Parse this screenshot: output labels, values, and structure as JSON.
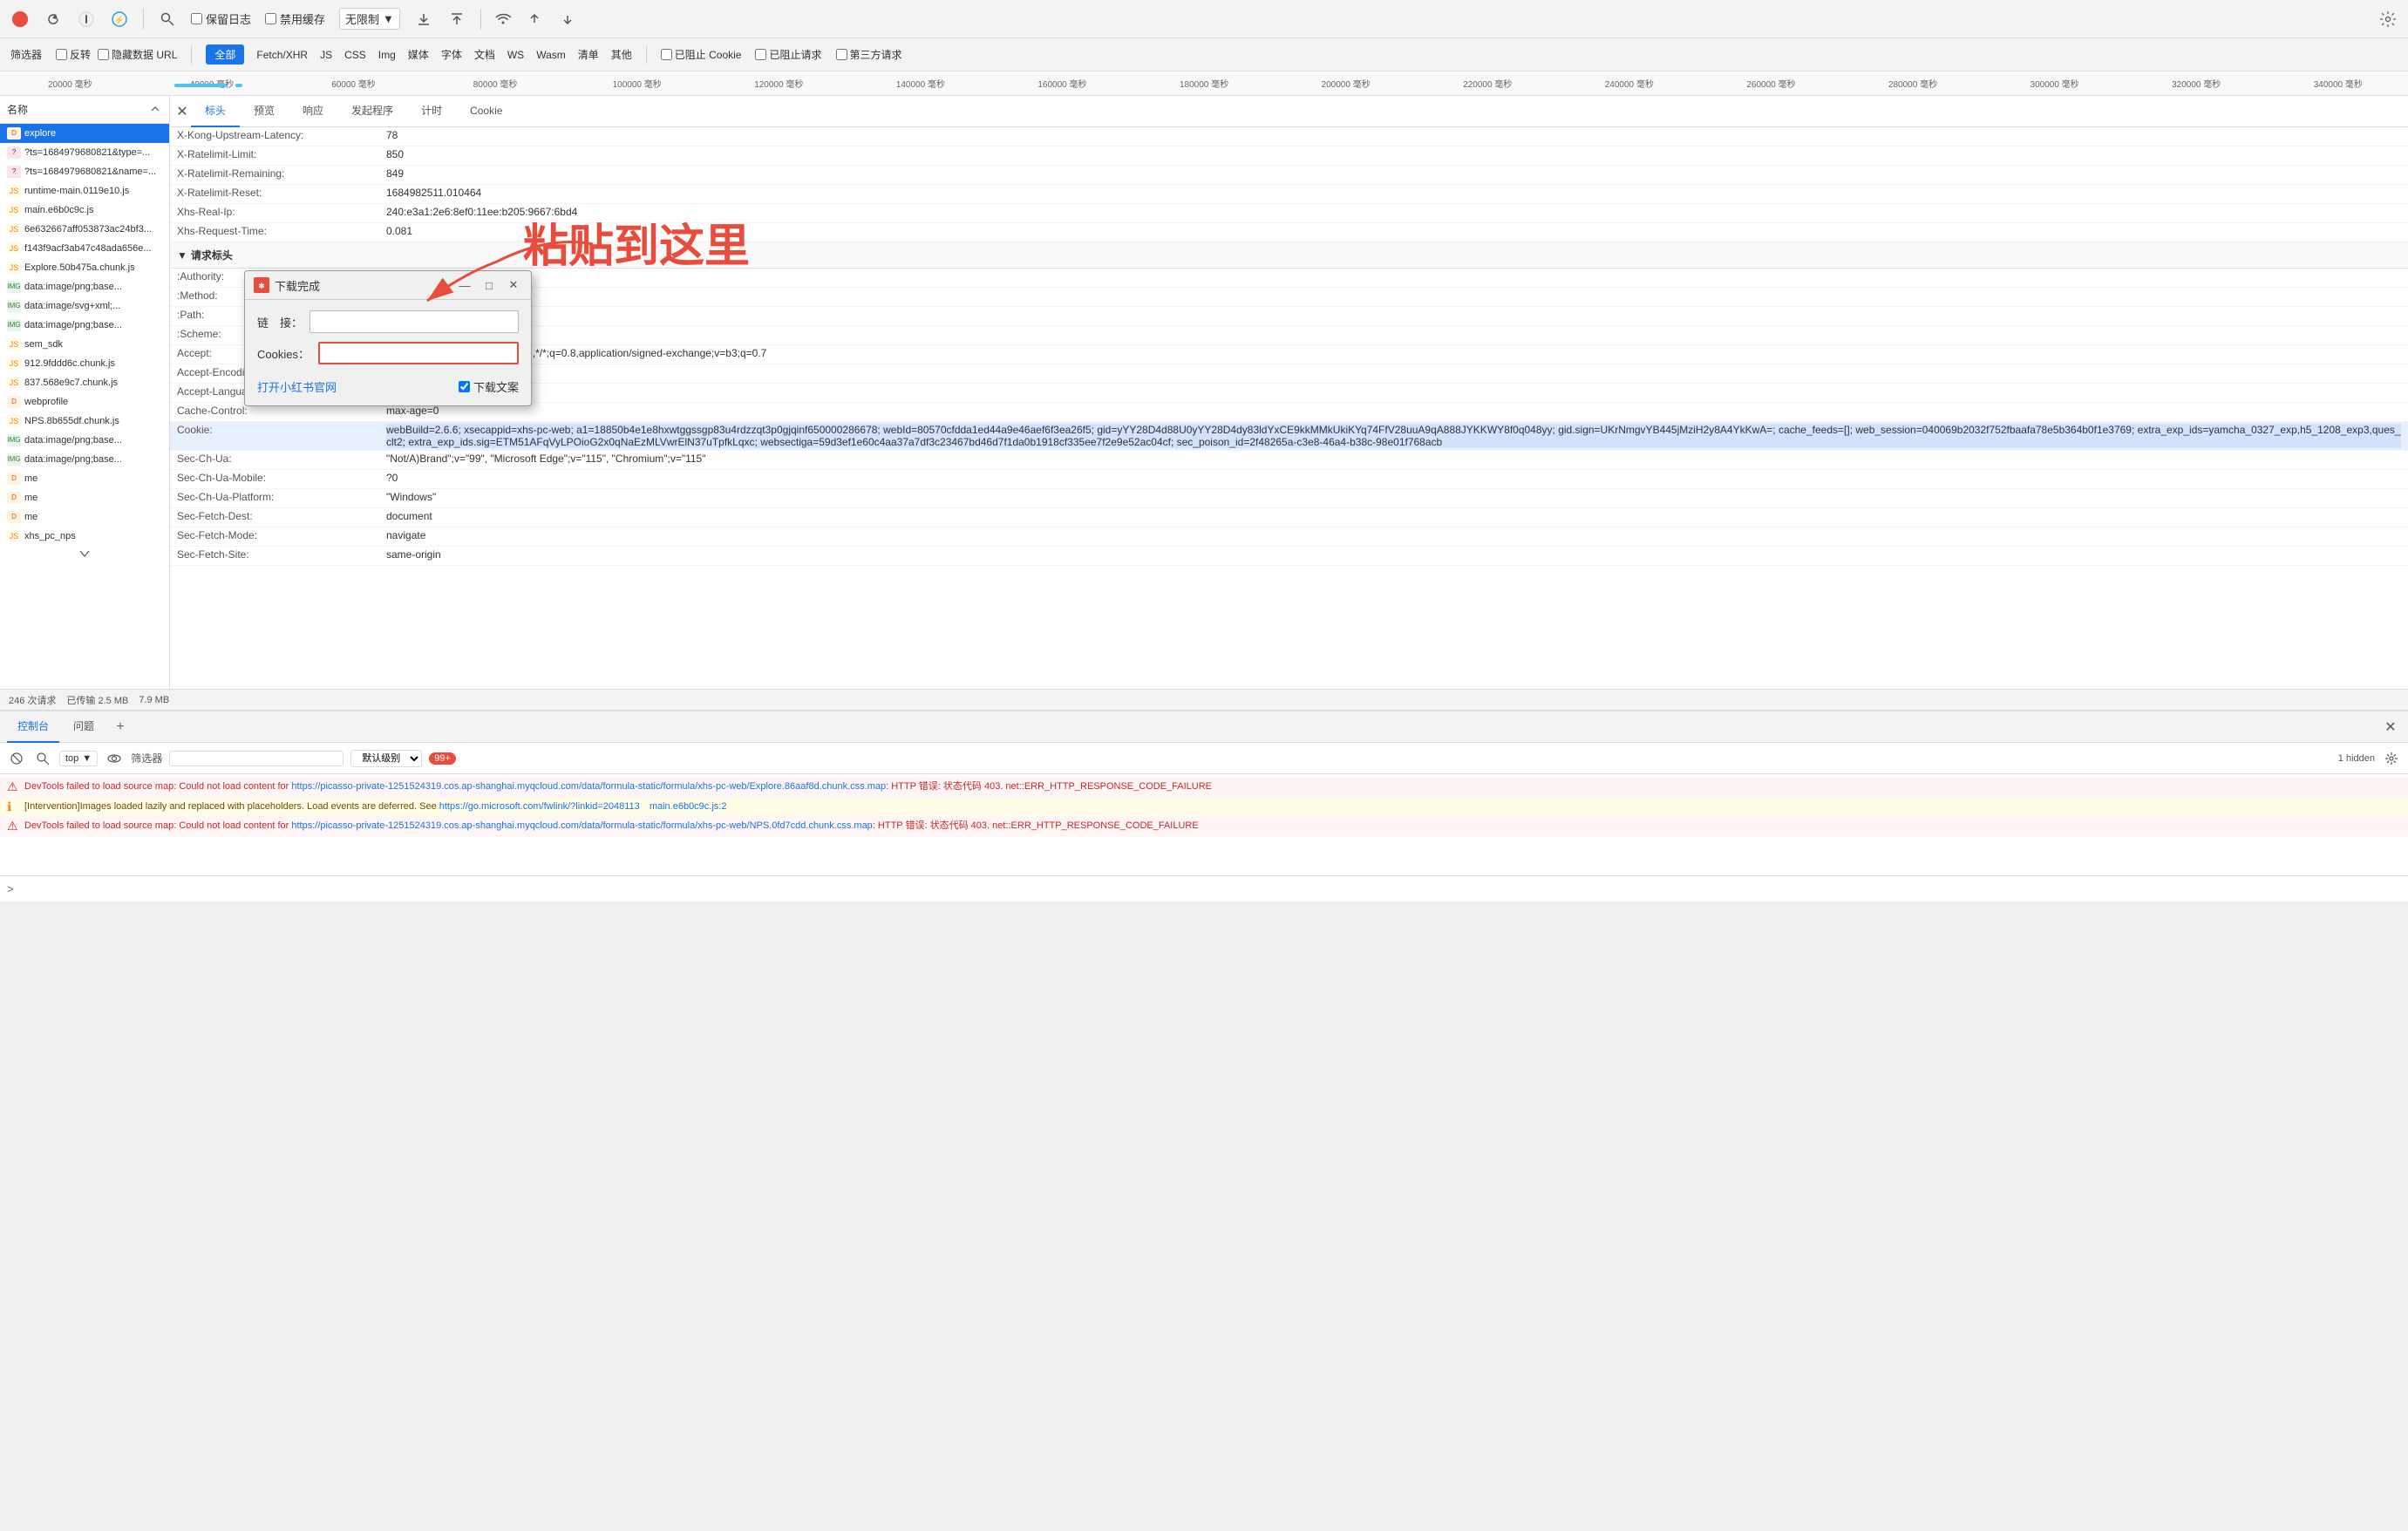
{
  "toolbar": {
    "stop_label": "⊘",
    "refresh_label": "↻",
    "keep_logs": "保留日志",
    "disable_cache": "禁用缓存",
    "no_limit": "无限制",
    "import_icon": "⬆",
    "export_icon": "⬇",
    "filter_label": "筛选器",
    "reverse_label": "反转",
    "hide_data_url": "隐藏数据 URL",
    "all_label": "全部",
    "fetch_xhr": "Fetch/XHR",
    "js": "JS",
    "css": "CSS",
    "img": "Img",
    "media": "媒体",
    "font": "字体",
    "doc": "文档",
    "ws": "WS",
    "wasm": "Wasm",
    "clear": "清单",
    "other": "其他",
    "blocked_cookies": "已阻止 Cookie",
    "blocked_requests": "已阻止请求",
    "third_party": "第三方请求",
    "gear": "⚙"
  },
  "network_items": [
    {
      "id": 1,
      "name": "explore",
      "type": "doc",
      "selected": true
    },
    {
      "id": 2,
      "name": "?ts=1684979680821&type=...",
      "type": "data"
    },
    {
      "id": 3,
      "name": "?ts=1684979680821&name=...",
      "type": "data"
    },
    {
      "id": 4,
      "name": "runtime-main.0119e10.js",
      "type": "js"
    },
    {
      "id": 5,
      "name": "main.e6b0c9c.js",
      "type": "js"
    },
    {
      "id": 6,
      "name": "6e632667aff053873ac24bf3...",
      "type": "js"
    },
    {
      "id": 7,
      "name": "f143f9acf3ab47c48ada656e...",
      "type": "js"
    },
    {
      "id": 8,
      "name": "Explore.50b475a.chunk.js",
      "type": "js"
    },
    {
      "id": 9,
      "name": "data:image/png;base...",
      "type": "img"
    },
    {
      "id": 10,
      "name": "data:image/svg+xml;...",
      "type": "img"
    },
    {
      "id": 11,
      "name": "data:image/png;base...",
      "type": "img"
    },
    {
      "id": 12,
      "name": "sem_sdk",
      "type": "js"
    },
    {
      "id": 13,
      "name": "912.9fddd6c.chunk.js",
      "type": "js"
    },
    {
      "id": 14,
      "name": "837.568e9c7.chunk.js",
      "type": "js"
    },
    {
      "id": 15,
      "name": "webprofile",
      "type": "doc"
    },
    {
      "id": 16,
      "name": "NPS.8b655df.chunk.js",
      "type": "js"
    },
    {
      "id": 17,
      "name": "data:image/png;base...",
      "type": "img"
    },
    {
      "id": 18,
      "name": "data:image/png;base...",
      "type": "img"
    },
    {
      "id": 19,
      "name": "me",
      "type": "doc"
    },
    {
      "id": 20,
      "name": "me",
      "type": "doc"
    },
    {
      "id": 21,
      "name": "me",
      "type": "doc"
    },
    {
      "id": 22,
      "name": "xhs_pc_nps",
      "type": "js"
    }
  ],
  "left_panel_header": "名称",
  "tabs": [
    "标头",
    "预览",
    "响应",
    "发起程序",
    "计时",
    "Cookie"
  ],
  "active_tab": "标头",
  "response_headers": [
    {
      "name": "X-Kong-Upstream-Latency:",
      "value": "78"
    },
    {
      "name": "X-Ratelimit-Limit:",
      "value": "850"
    },
    {
      "name": "X-Ratelimit-Remaining:",
      "value": "849"
    },
    {
      "name": "X-Ratelimit-Reset:",
      "value": "1684982511.010464"
    },
    {
      "name": "Xhs-Real-Ip:",
      "value": "240:e3a1:2e6:8ef0:11ee:b205:9667:6bd4"
    },
    {
      "name": "Xhs-Request-Time:",
      "value": "0.081"
    }
  ],
  "request_headers_title": "请求标头",
  "request_headers": [
    {
      "name": ":Authority:",
      "value": ""
    },
    {
      "name": ":Method:",
      "value": ""
    },
    {
      "name": ":Path:",
      "value": ""
    },
    {
      "name": ":Scheme:",
      "value": ""
    },
    {
      "name": "Accept:",
      "value": ";q=0.9,image/webp,image/apng,*/*;q=0.8,application/signed-exchange;v=b3;q=0.7"
    },
    {
      "name": "Accept-Encoding:",
      "value": ""
    },
    {
      "name": "Accept-Language:",
      "value": ";q=0.6"
    },
    {
      "name": "Cache-Control:",
      "value": "max-age=0"
    },
    {
      "name": "Cookie:",
      "value": "webBuild=2.6.6; xsecappid=xhs-pc-web; a1=18850b4e1e8hxwtggssgp83u4rdzzqt3p0gjqinf650000286678; webId=80570cfdda1ed44a9e46aef6f3ea26f5; gid=yYY28D4d88U0yYY28D4dy83ldYxCE9kkMMkUkiKYq74FfV28uuA9qA888JYKKWY8f0q048yy; gid.sign=UKrNmgvYB445jMziH2y8A4YkKwA=; cache_feeds=[]; web_session=040069b2032f752fbaafa78e5b364b0f1e3769; extra_exp_ids=yamcha_0327_exp,h5_1208_exp3,ques_clt2; extra_exp_ids.sig=ETM51AFqVyLPOioG2x0qNaEzMLVwrElN37uTpfkLqxc; websectiga=59d3ef1e60c4aa37a7df3c23467bd46d7f1da0b1918cf335ee7f2e9e52ac04cf; sec_poison_id=2f48265a-c3e8-46a4-b38c-98e01f768acb"
    },
    {
      "name": "Sec-Ch-Ua:",
      "value": "\"Not/A)Brand\";v=\"99\", \"Microsoft Edge\";v=\"115\", \"Chromium\";v=\"115\""
    },
    {
      "name": "Sec-Ch-Ua-Mobile:",
      "value": "?0"
    },
    {
      "name": "Sec-Ch-Ua-Platform:",
      "value": "\"Windows\""
    },
    {
      "name": "Sec-Fetch-Dest:",
      "value": "document"
    },
    {
      "name": "Sec-Fetch-Mode:",
      "value": "navigate"
    },
    {
      "name": "Sec-Fetch-Site:",
      "value": "same-origin"
    }
  ],
  "status_bar": {
    "requests": "246 次请求",
    "transferred": "已传输 2.5 MB",
    "size": "7.9 MB"
  },
  "console": {
    "tabs": [
      "控制台",
      "问题"
    ],
    "add_tab": "+",
    "active_tab": "控制台",
    "toolbar": {
      "clear": "🚫",
      "top_context": "top",
      "filter_placeholder": "筛选器",
      "level": "默认级别",
      "badge": "99+",
      "hidden": "1 hidden"
    },
    "messages": [
      {
        "type": "error",
        "text": "DevTools failed to load source map: Could not load content for ",
        "link1": "https://picasso-private-1251524319.cos.ap-shanghai.myqcloud.com/data/formula-static/formula/xhs-pc-web/Explore.86aaf8d.chunk.css.map",
        "middle": ": HTTP 错误: 状态代码 403. net::ERR_HTTP_RESPONSE_CODE_FAILURE",
        "link2": "",
        "source": ""
      },
      {
        "type": "warning",
        "text": "[Intervention]Images loaded lazily and replaced with placeholders. Load events are deferred. See ",
        "link1": "https://go.microsoft.com/fwlink/?linkid=2048113",
        "middle": "",
        "link2": "",
        "source": "main.e6b0c9c.js:2"
      },
      {
        "type": "error",
        "text": "DevTools failed to load source map: Could not load content for ",
        "link1": "https://picasso-private-1251524319.cos.ap-shanghai.myqcloud.com/data/formula-static/formula/xhs-pc-web/NPS.0fd7cdd.chunk.css.map",
        "middle": ": HTTP 错误: 状态代码 403. net::ERR_HTTP_RESPONSE_CODE_FAILURE",
        "link2": "",
        "source": ""
      }
    ],
    "input_prompt": ">",
    "input_placeholder": ""
  },
  "dialog": {
    "title": "下载完成",
    "logo_text": "🔴",
    "link_label": "链　接：",
    "link_value": "",
    "cookies_label": "Cookies：",
    "cookies_value": "",
    "open_button": "打开小红书官网",
    "download_checkbox": "下载文案",
    "download_checked": true
  },
  "annotation": {
    "text": "粘贴到这里",
    "arrow": "→"
  },
  "timeline_labels": [
    "20000 毫秒",
    "40000 毫秒",
    "60000 毫秒",
    "80000 毫秒",
    "100000 毫秒",
    "120000 毫秒",
    "140000 毫秒",
    "160000 毫秒",
    "180000 毫秒",
    "200000 毫秒",
    "220000 毫秒",
    "240000 毫秒",
    "260000 毫秒",
    "280000 毫秒",
    "300000 毫秒",
    "320000 毫秒",
    "340000 毫秒"
  ]
}
